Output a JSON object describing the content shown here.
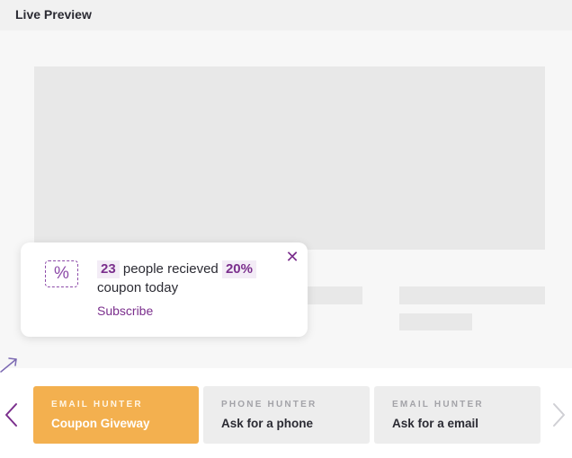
{
  "header": {
    "title": "Live Preview"
  },
  "popup": {
    "count": "23",
    "text_middle": "people recieved",
    "discount": "20%",
    "text_end": "coupon today",
    "link_label": "Subscribe",
    "close_glyph": "✕",
    "icon_glyph": "%",
    "icon": "percent-coupon-icon",
    "accent_color": "#7b2f8d"
  },
  "carousel": {
    "prev_icon": "chevron-left-icon",
    "next_icon": "chevron-right-icon",
    "cards": [
      {
        "type": "EMAIL HUNTER",
        "title": "Coupon Giveway",
        "active": true
      },
      {
        "type": "PHONE HUNTER",
        "title": "Ask for a phone",
        "active": false
      },
      {
        "type": "EMAIL HUNTER",
        "title": "Ask for a email",
        "active": false
      }
    ],
    "active_color": "#f3b04f",
    "inactive_color": "#ededed"
  }
}
